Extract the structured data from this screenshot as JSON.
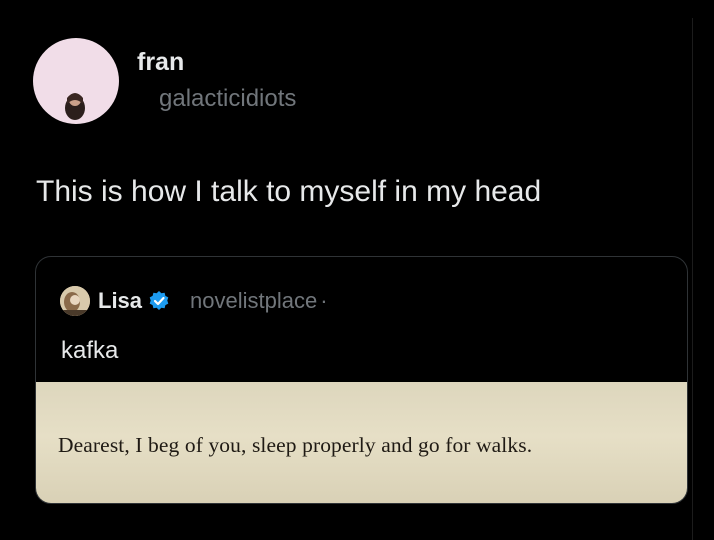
{
  "tweet": {
    "author": {
      "display_name": "fran",
      "handle": "galacticidiots",
      "avatar_icon": "profile-photo"
    },
    "text": "This is how I talk to myself in my head"
  },
  "quoted_tweet": {
    "author": {
      "display_name": "Lisa",
      "handle": "novelistplace",
      "separator": "·",
      "verified": true,
      "avatar_icon": "profile-photo"
    },
    "text": "kafka",
    "image_text": "Dearest, I beg of you, sleep properly and go for walks."
  },
  "colors": {
    "background": "#000000",
    "primary_text": "#e7e9ea",
    "secondary_text": "#71767b",
    "verified_badge": "#1d9bf0",
    "card_border": "#2f3336",
    "paper": "#e2dbc2"
  }
}
